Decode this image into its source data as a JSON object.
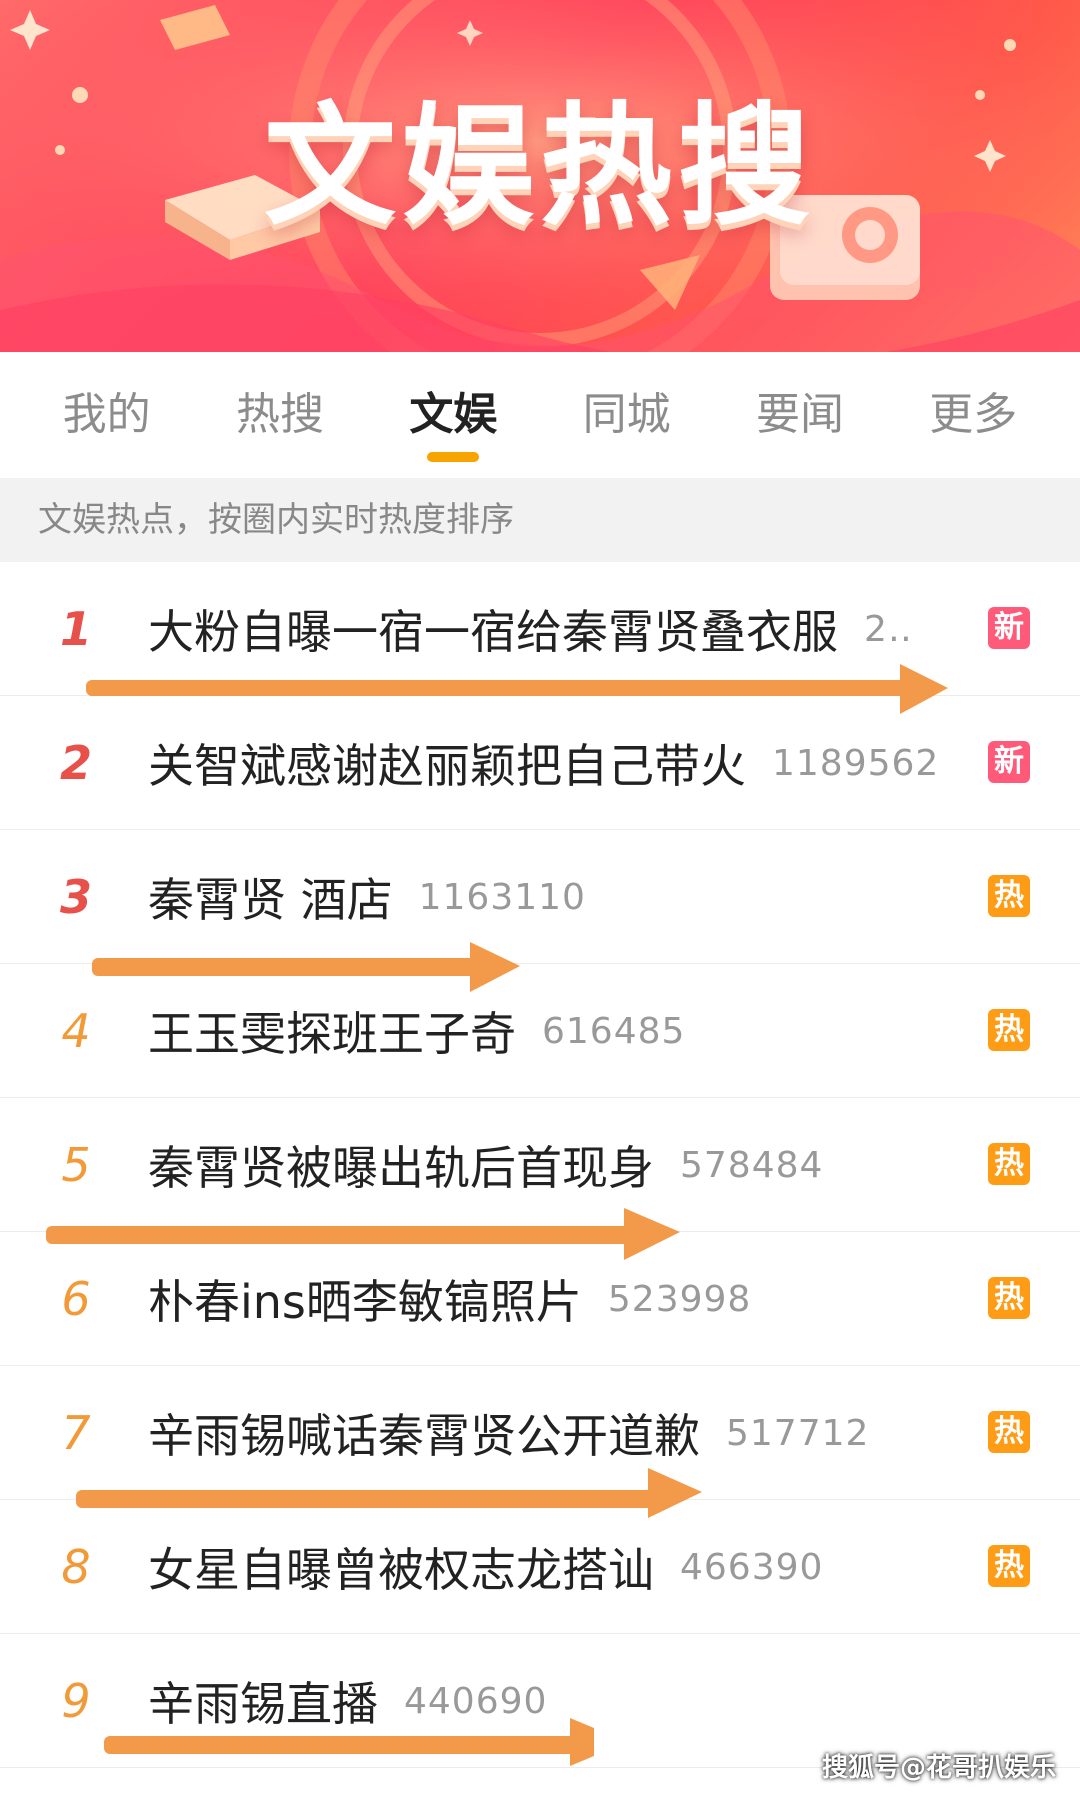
{
  "banner": {
    "title": "文娱热搜"
  },
  "tabs": [
    {
      "label": "我的",
      "active": false
    },
    {
      "label": "热搜",
      "active": false
    },
    {
      "label": "文娱",
      "active": true
    },
    {
      "label": "同城",
      "active": false
    },
    {
      "label": "要闻",
      "active": false
    },
    {
      "label": "更多",
      "active": false
    }
  ],
  "subtitle": "文娱热点，按圈内实时热度排序",
  "list": [
    {
      "rank": "1",
      "text": "大粉自曝一宿一宿给秦霄贤叠衣服",
      "count": "2…",
      "badge": "新",
      "badge_type": "new"
    },
    {
      "rank": "2",
      "text": "关智斌感谢赵丽颖把自己带火",
      "count": "1189562",
      "badge": "新",
      "badge_type": "new"
    },
    {
      "rank": "3",
      "text": "秦霄贤 酒店",
      "count": "1163110",
      "badge": "热",
      "badge_type": "hot"
    },
    {
      "rank": "4",
      "text": "王玉雯探班王子奇",
      "count": "616485",
      "badge": "热",
      "badge_type": "hot"
    },
    {
      "rank": "5",
      "text": "秦霄贤被曝出轨后首现身",
      "count": "578484",
      "badge": "热",
      "badge_type": "hot"
    },
    {
      "rank": "6",
      "text": "朴春ins晒李敏镐照片",
      "count": "523998",
      "badge": "热",
      "badge_type": "hot"
    },
    {
      "rank": "7",
      "text": "辛雨锡喊话秦霄贤公开道歉",
      "count": "517712",
      "badge": "热",
      "badge_type": "hot"
    },
    {
      "rank": "8",
      "text": "女星自曝曾被权志龙搭讪",
      "count": "466390",
      "badge": "热",
      "badge_type": "hot"
    },
    {
      "rank": "9",
      "text": "辛雨锡直播",
      "count": "440690",
      "badge": "",
      "badge_type": "none"
    }
  ],
  "watermark": "搜狐号@花哥扒娱乐",
  "colors": {
    "accent_tab_underline": "#f7a300",
    "rank_top": "#e8504a",
    "rank_rest": "#f29a38",
    "badge_new": "#ff5a7a",
    "badge_hot": "#ff9c16",
    "annotation_arrow": "#f39a4a"
  }
}
